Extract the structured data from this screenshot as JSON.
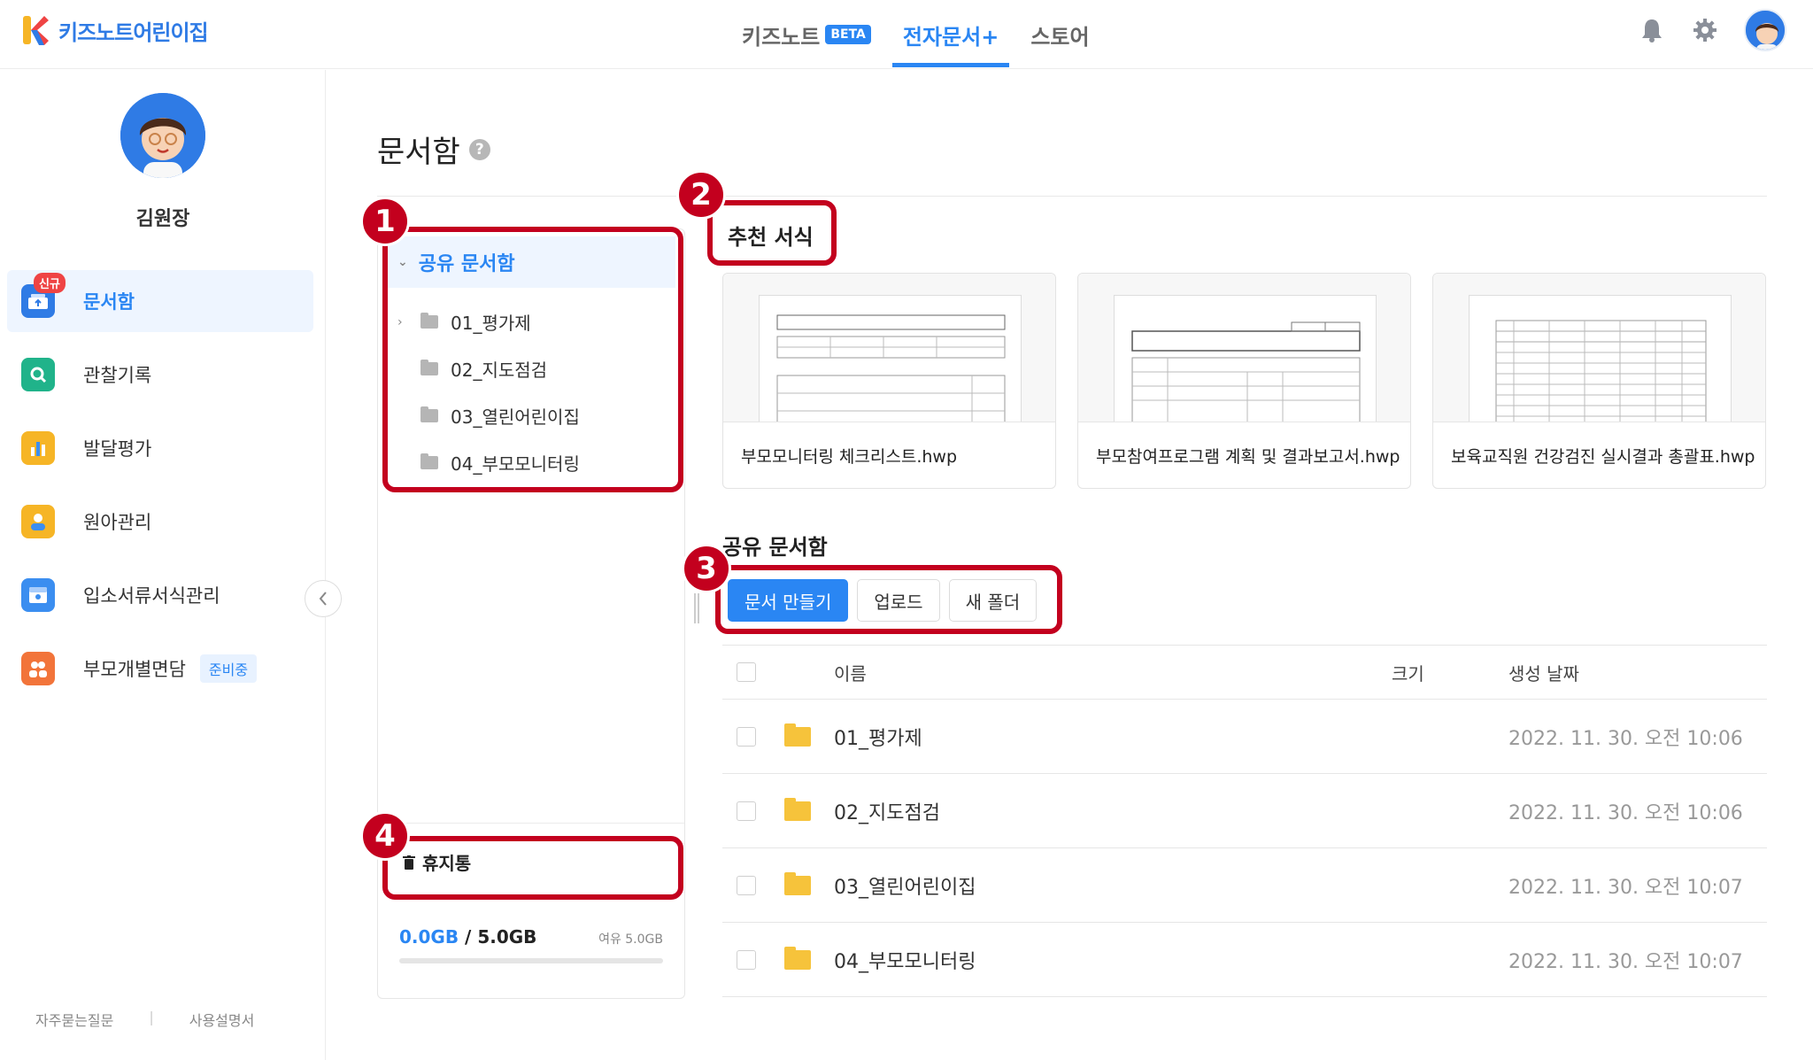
{
  "app": {
    "brand_name": "키즈노트어린이집",
    "nav": [
      {
        "label": "키즈노트",
        "badge": "BETA"
      },
      {
        "label": "전자문서+"
      },
      {
        "label": "스토어"
      }
    ],
    "active_nav": "전자문서+",
    "icons": [
      "bell-icon",
      "gear-icon",
      "avatar"
    ]
  },
  "sidebar": {
    "user_name": "김원장",
    "menu": [
      {
        "label": "문서함",
        "icon": "document-box-icon",
        "badge": "신규",
        "active": true,
        "color": "#2f7be5"
      },
      {
        "label": "관찰기록",
        "icon": "magnifier-icon",
        "color": "#20b38a"
      },
      {
        "label": "발달평가",
        "icon": "bar-chart-icon",
        "color": "#f6b526"
      },
      {
        "label": "원아관리",
        "icon": "children-icon",
        "color": "#f6b526"
      },
      {
        "label": "입소서류서식관리",
        "icon": "form-icon",
        "color": "#3b8ef0"
      },
      {
        "label": "부모개별면담",
        "icon": "people-icon",
        "badge": "준비중",
        "color": "#f2743a"
      }
    ],
    "footer": [
      "자주묻는질문",
      "사용설명서"
    ]
  },
  "page": {
    "title": "문서함"
  },
  "folders": {
    "root": "공유 문서함",
    "items": [
      "01_평가제",
      "02_지도점검",
      "03_열린어린이집",
      "04_부모모니터링"
    ],
    "trash": "휴지통",
    "storage_used": "0.0GB",
    "storage_total": "5.0GB",
    "storage_free": "여유 5.0GB",
    "storage_fraction": 0.0
  },
  "recommended": {
    "label": "추천 서식",
    "templates": [
      {
        "name": "부모모니터링 체크리스트.hwp"
      },
      {
        "name": "부모참여프로그램 계획 및 결과보고서.hwp"
      },
      {
        "name": "보육교직원 건강검진 실시결과 총괄표.hwp"
      }
    ]
  },
  "shared": {
    "label": "공유 문서함",
    "buttons": {
      "create": "문서 만들기",
      "upload": "업로드",
      "new_folder": "새 폴더"
    },
    "columns": {
      "name": "이름",
      "size": "크기",
      "date": "생성 날짜"
    },
    "rows": [
      {
        "name": "01_평가제",
        "size": "",
        "date": "2022. 11. 30. 오전 10:06"
      },
      {
        "name": "02_지도점검",
        "size": "",
        "date": "2022. 11. 30. 오전 10:06"
      },
      {
        "name": "03_열린어린이집",
        "size": "",
        "date": "2022. 11. 30. 오전 10:07"
      },
      {
        "name": "04_부모모니터링",
        "size": "",
        "date": "2022. 11. 30. 오전 10:07"
      }
    ]
  },
  "annotations": {
    "numbers": [
      "1",
      "2",
      "3",
      "4"
    ],
    "color": "#c3001e"
  },
  "colors": {
    "accent": "#2a86f3",
    "folder_yellow": "#f6c33b"
  }
}
